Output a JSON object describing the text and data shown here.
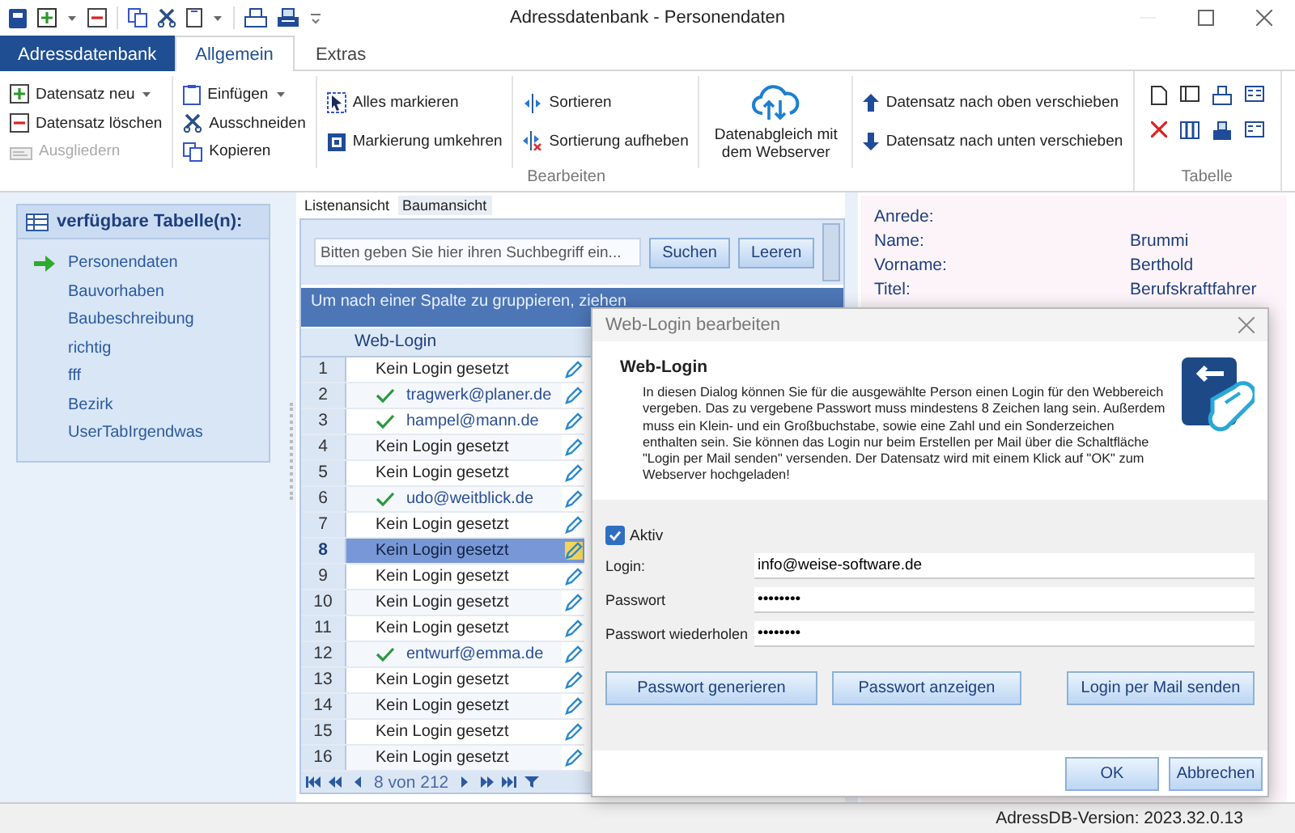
{
  "window": {
    "title": "Adressdatenbank - Personendaten"
  },
  "ribbon_tabs": [
    {
      "label": "Adressdatenbank",
      "kind": "app",
      "selected": false
    },
    {
      "label": "Allgemein",
      "kind": "tab",
      "selected": true
    },
    {
      "label": "Extras",
      "kind": "tab",
      "selected": false
    }
  ],
  "ribbon": {
    "groups": [
      {
        "label": "Bearbeiten",
        "kind": "commands",
        "columns": [
          {
            "kind": "small",
            "buttons": [
              {
                "label": "Datensatz neu",
                "dropdown": true,
                "disabled": false
              },
              {
                "label": "Datensatz löschen",
                "dropdown": false,
                "disabled": false
              },
              {
                "label": "Ausgliedern",
                "dropdown": false,
                "disabled": true
              }
            ]
          },
          {
            "kind": "small",
            "buttons": [
              {
                "label": "Einfügen",
                "dropdown": true,
                "disabled": false
              },
              {
                "label": "Ausschneiden",
                "dropdown": false,
                "disabled": false
              },
              {
                "label": "Kopieren",
                "dropdown": false,
                "disabled": false
              }
            ]
          },
          {
            "kind": "small",
            "buttons": [
              {
                "label": "Alles markieren",
                "dropdown": false,
                "disabled": false
              },
              {
                "label": "Markierung umkehren",
                "dropdown": false,
                "disabled": false
              }
            ]
          },
          {
            "kind": "small",
            "buttons": [
              {
                "label": "Sortieren",
                "dropdown": false,
                "disabled": false
              },
              {
                "label": "Sortierung aufheben",
                "dropdown": false,
                "disabled": false
              }
            ]
          },
          {
            "kind": "large",
            "buttons": [
              {
                "label": "Datenabgleich mit dem Webserver",
                "dropdown": false,
                "disabled": false
              }
            ]
          },
          {
            "kind": "small",
            "buttons": [
              {
                "label": "Datensatz nach oben verschieben",
                "dropdown": false,
                "disabled": false
              },
              {
                "label": "Datensatz nach unten verschieben",
                "dropdown": false,
                "disabled": false
              }
            ]
          }
        ]
      },
      {
        "label": "Tabelle",
        "kind": "icons"
      }
    ]
  },
  "sidebar": {
    "title": "verfügbare Tabelle(n):",
    "items": [
      {
        "label": "Personendaten",
        "selected": true
      },
      {
        "label": "Bauvorhaben",
        "selected": false
      },
      {
        "label": "Baubeschreibung",
        "selected": false
      },
      {
        "label": "richtig",
        "selected": false
      },
      {
        "label": "fff",
        "selected": false
      },
      {
        "label": "Bezirk",
        "selected": false
      },
      {
        "label": "UserTabIrgendwas",
        "selected": false
      }
    ]
  },
  "views": {
    "tabs": [
      {
        "label": "Listenansicht",
        "selected": true
      },
      {
        "label": "Baumansicht",
        "selected": false
      }
    ]
  },
  "search": {
    "placeholder": "Bitten geben Sie hier ihren Suchbegriff ein...",
    "buttons": [
      "Suchen",
      "Leeren"
    ]
  },
  "grid": {
    "group_hint": "Um nach einer Spalte zu gruppieren, ziehen",
    "columns": [
      "Web-Login"
    ],
    "rows": [
      {
        "number": "1",
        "login": "Kein Login gesetzt",
        "has_login": false,
        "selected": false
      },
      {
        "number": "2",
        "login": "tragwerk@planer.de",
        "has_login": true,
        "selected": false
      },
      {
        "number": "3",
        "login": "hampel@mann.de",
        "has_login": true,
        "selected": false
      },
      {
        "number": "4",
        "login": "Kein Login gesetzt",
        "has_login": false,
        "selected": false
      },
      {
        "number": "5",
        "login": "Kein Login gesetzt",
        "has_login": false,
        "selected": false
      },
      {
        "number": "6",
        "login": "udo@weitblick.de",
        "has_login": true,
        "selected": false
      },
      {
        "number": "7",
        "login": "Kein Login gesetzt",
        "has_login": false,
        "selected": false
      },
      {
        "number": "8",
        "login": "Kein Login gesetzt",
        "has_login": false,
        "selected": true
      },
      {
        "number": "9",
        "login": "Kein Login gesetzt",
        "has_login": false,
        "selected": false
      },
      {
        "number": "10",
        "login": "Kein Login gesetzt",
        "has_login": false,
        "selected": false
      },
      {
        "number": "11",
        "login": "Kein Login gesetzt",
        "has_login": false,
        "selected": false
      },
      {
        "number": "12",
        "login": "entwurf@emma.de",
        "has_login": true,
        "selected": false
      },
      {
        "number": "13",
        "login": "Kein Login gesetzt",
        "has_login": false,
        "selected": false
      },
      {
        "number": "14",
        "login": "Kein Login gesetzt",
        "has_login": false,
        "selected": false
      },
      {
        "number": "15",
        "login": "Kein Login gesetzt",
        "has_login": false,
        "selected": false
      },
      {
        "number": "16",
        "login": "Kein Login gesetzt",
        "has_login": false,
        "selected": false
      }
    ]
  },
  "navigator": {
    "position": "8 von 212"
  },
  "details": [
    {
      "label": "Anrede:"
    },
    {
      "label": "Name:",
      "value": "Brummi"
    },
    {
      "label": "Vorname:",
      "value": "Berthold"
    },
    {
      "label": "Titel:",
      "value": "Berufskraftfahrer"
    }
  ],
  "dialog": {
    "title": "Web-Login bearbeiten",
    "heading": "Web-Login",
    "text": "In diesen Dialog können Sie für die ausgewählte Person einen Login für den Webbereich vergeben. Das zu vergebene Passwort muss mindestens 8 Zeichen lang sein. Außerdem muss ein Klein- und ein Großbuchstabe, sowie eine Zahl und ein Sonderzeichen enthalten sein. Sie können das Login nur beim Erstellen per Mail über die Schaltfläche \"Login per Mail senden\" versenden. Der Datensatz wird mit einem Klick auf \"OK\" zum Webserver hochgeladen!",
    "active": {
      "label": "Aktiv",
      "checked": true
    },
    "fields": [
      {
        "label": "Login:",
        "value": "info@weise-software.de"
      },
      {
        "label": "Passwort",
        "value": "••••••••"
      },
      {
        "label": "Passwort wiederholen",
        "value": "••••••••"
      }
    ],
    "actions": [
      "Passwort generieren",
      "Passwort anzeigen",
      "Login per Mail senden"
    ],
    "buttons": [
      "OK",
      "Abbrechen"
    ]
  },
  "status_bar": {
    "version": "AdressDB-Version: 2023.32.0.13"
  }
}
